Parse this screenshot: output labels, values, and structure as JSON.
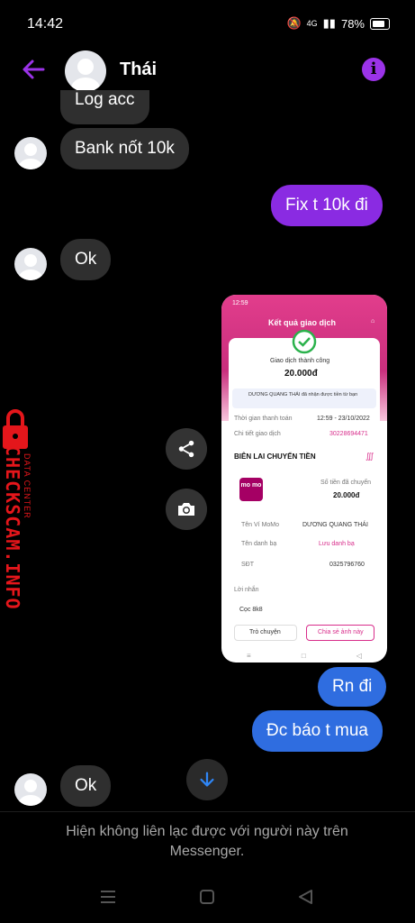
{
  "status": {
    "time": "14:42",
    "network": "4G",
    "battery": "78%"
  },
  "header": {
    "name": "Thái"
  },
  "messages": [
    {
      "text": "Log acc"
    },
    {
      "text": "Bank nốt 10k"
    },
    {
      "text": "Fix t 10k đi"
    },
    {
      "text": "Ok"
    },
    {
      "text": "Rn đi"
    },
    {
      "text": "Đc báo t mua"
    },
    {
      "text": "Ok"
    }
  ],
  "shared_image": {
    "status_time": "12:59",
    "title": "Kết quả giao dịch",
    "success": "Giao dịch thành công",
    "amount": "20.000đ",
    "notice": "DƯƠNG QUANG THÁI đã nhận được tiền từ bạn",
    "time_label": "Thời gian thanh toán",
    "time_value": "12:59 - 23/10/2022",
    "detail_label": "Chi tiết giao dịch",
    "detail_value": "30228694471",
    "receipt_title": "BIÊN LAI CHUYỂN TIỀN",
    "logo": "mo mo",
    "sent_label": "Số tiền đã chuyển",
    "sent_value": "20.000đ",
    "wallet_label": "Tên Ví MoMo",
    "wallet_value": "DƯƠNG QUANG THÁI",
    "contact_label": "Tên danh bạ",
    "contact_value": "Lưu danh bạ",
    "phone_label": "SĐT",
    "phone_value": "0325796760",
    "message_label": "Lời nhắn",
    "message_value": "Cọc 8k8",
    "btn_chat": "Trò chuyện",
    "btn_share": "Chia sẻ ảnh này"
  },
  "watermark": {
    "brand": "CHECKSCAM.INFO",
    "sub": "DATA CENTER",
    "color": "#e4161b"
  },
  "footer": {
    "note": "Hiện không liên lạc được với người này trên Messenger."
  },
  "colors": {
    "accent": "#9b33e8",
    "outgoing": "#8a2be2",
    "outgoing_blue": "#2f6de0"
  }
}
